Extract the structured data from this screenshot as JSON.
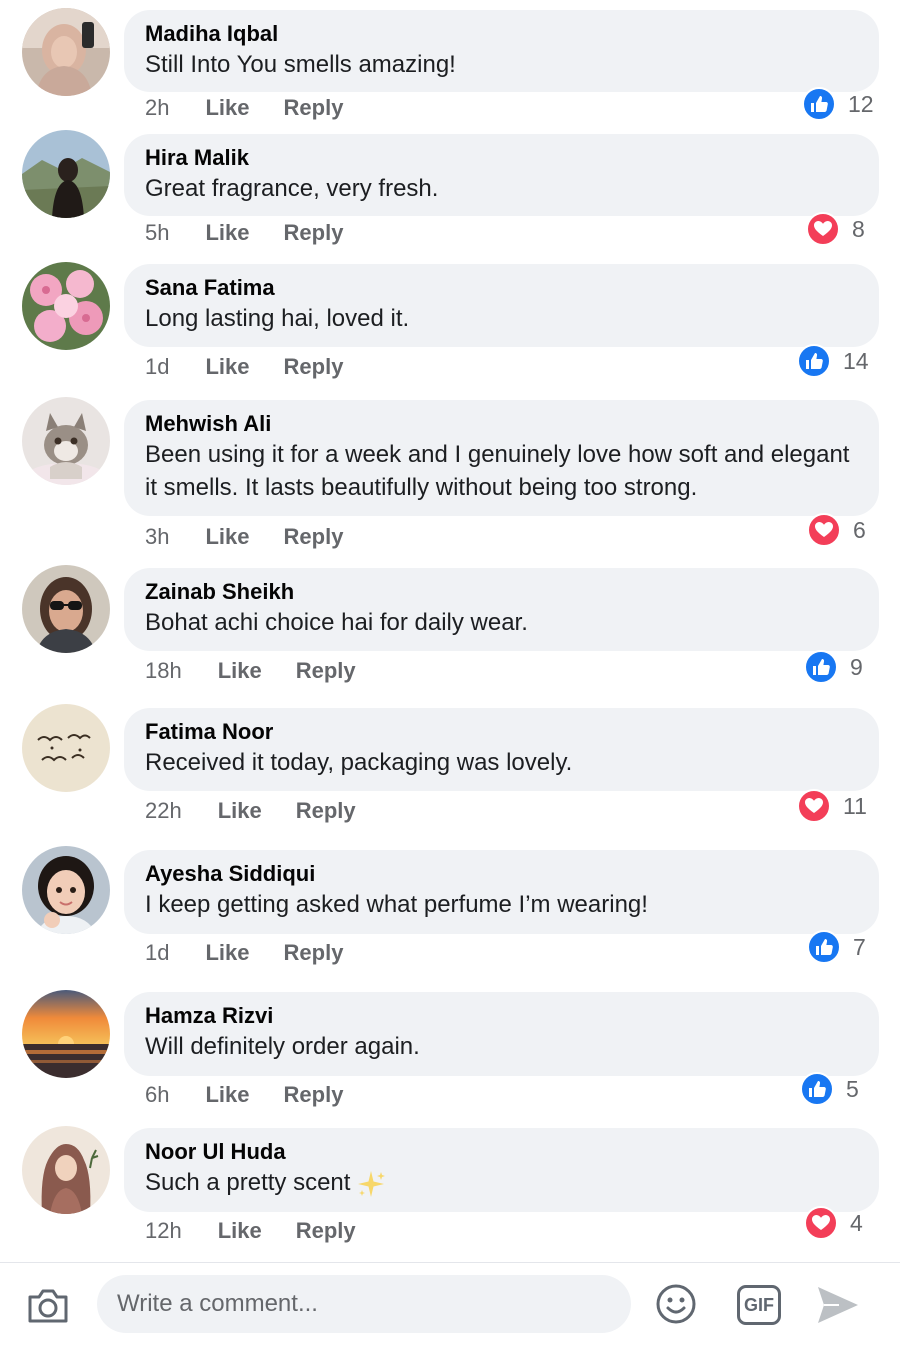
{
  "comments": [
    {
      "author": "Madiha Iqbal",
      "text": "Still Into You smells amazing!",
      "time": "2h",
      "like_label": "Like",
      "reply_label": "Reply",
      "reaction": "like",
      "reaction_count": "12"
    },
    {
      "author": "Hira Malik",
      "text": "Great fragrance, very fresh.",
      "time": "5h",
      "like_label": "Like",
      "reply_label": "Reply",
      "reaction": "love",
      "reaction_count": "8"
    },
    {
      "author": "Sana Fatima",
      "text": "Long lasting hai, loved it.",
      "time": "1d",
      "like_label": "Like",
      "reply_label": "Reply",
      "reaction": "like",
      "reaction_count": "14"
    },
    {
      "author": "Mehwish Ali",
      "text": "Been using it for a week and I genuinely love how soft and elegant it smells. It lasts beautifully without being too strong.",
      "time": "3h",
      "like_label": "Like",
      "reply_label": "Reply",
      "reaction": "love",
      "reaction_count": "6"
    },
    {
      "author": "Zainab Sheikh",
      "text": "Bohat achi choice hai for daily wear.",
      "time": "18h",
      "like_label": "Like",
      "reply_label": "Reply",
      "reaction": "like",
      "reaction_count": "9"
    },
    {
      "author": "Fatima Noor",
      "text": "Received it today, packaging was lovely.",
      "time": "22h",
      "like_label": "Like",
      "reply_label": "Reply",
      "reaction": "love",
      "reaction_count": "11"
    },
    {
      "author": "Ayesha Siddiqui",
      "text": "I keep getting asked what perfume I’m wearing!",
      "time": "1d",
      "like_label": "Like",
      "reply_label": "Reply",
      "reaction": "like",
      "reaction_count": "7"
    },
    {
      "author": "Hamza Rizvi",
      "text": "Will definitely order again.",
      "time": "6h",
      "like_label": "Like",
      "reply_label": "Reply",
      "reaction": "like",
      "reaction_count": "5"
    },
    {
      "author": "Noor Ul Huda",
      "text": "Such a pretty scent",
      "time": "12h",
      "like_label": "Like",
      "reply_label": "Reply",
      "reaction": "love",
      "reaction_count": "4"
    }
  ],
  "composer": {
    "placeholder": "Write a comment...",
    "gif_label": "GIF"
  },
  "colors": {
    "like_blue": "#1877f2",
    "love_red": "#f33e58",
    "bubble_bg": "#f0f2f5",
    "meta_gray": "#65676b"
  },
  "icons": [
    "camera-icon",
    "emoji-icon",
    "gif-icon",
    "send-icon",
    "like-reaction-icon",
    "love-reaction-icon",
    "sparkle-icon"
  ]
}
